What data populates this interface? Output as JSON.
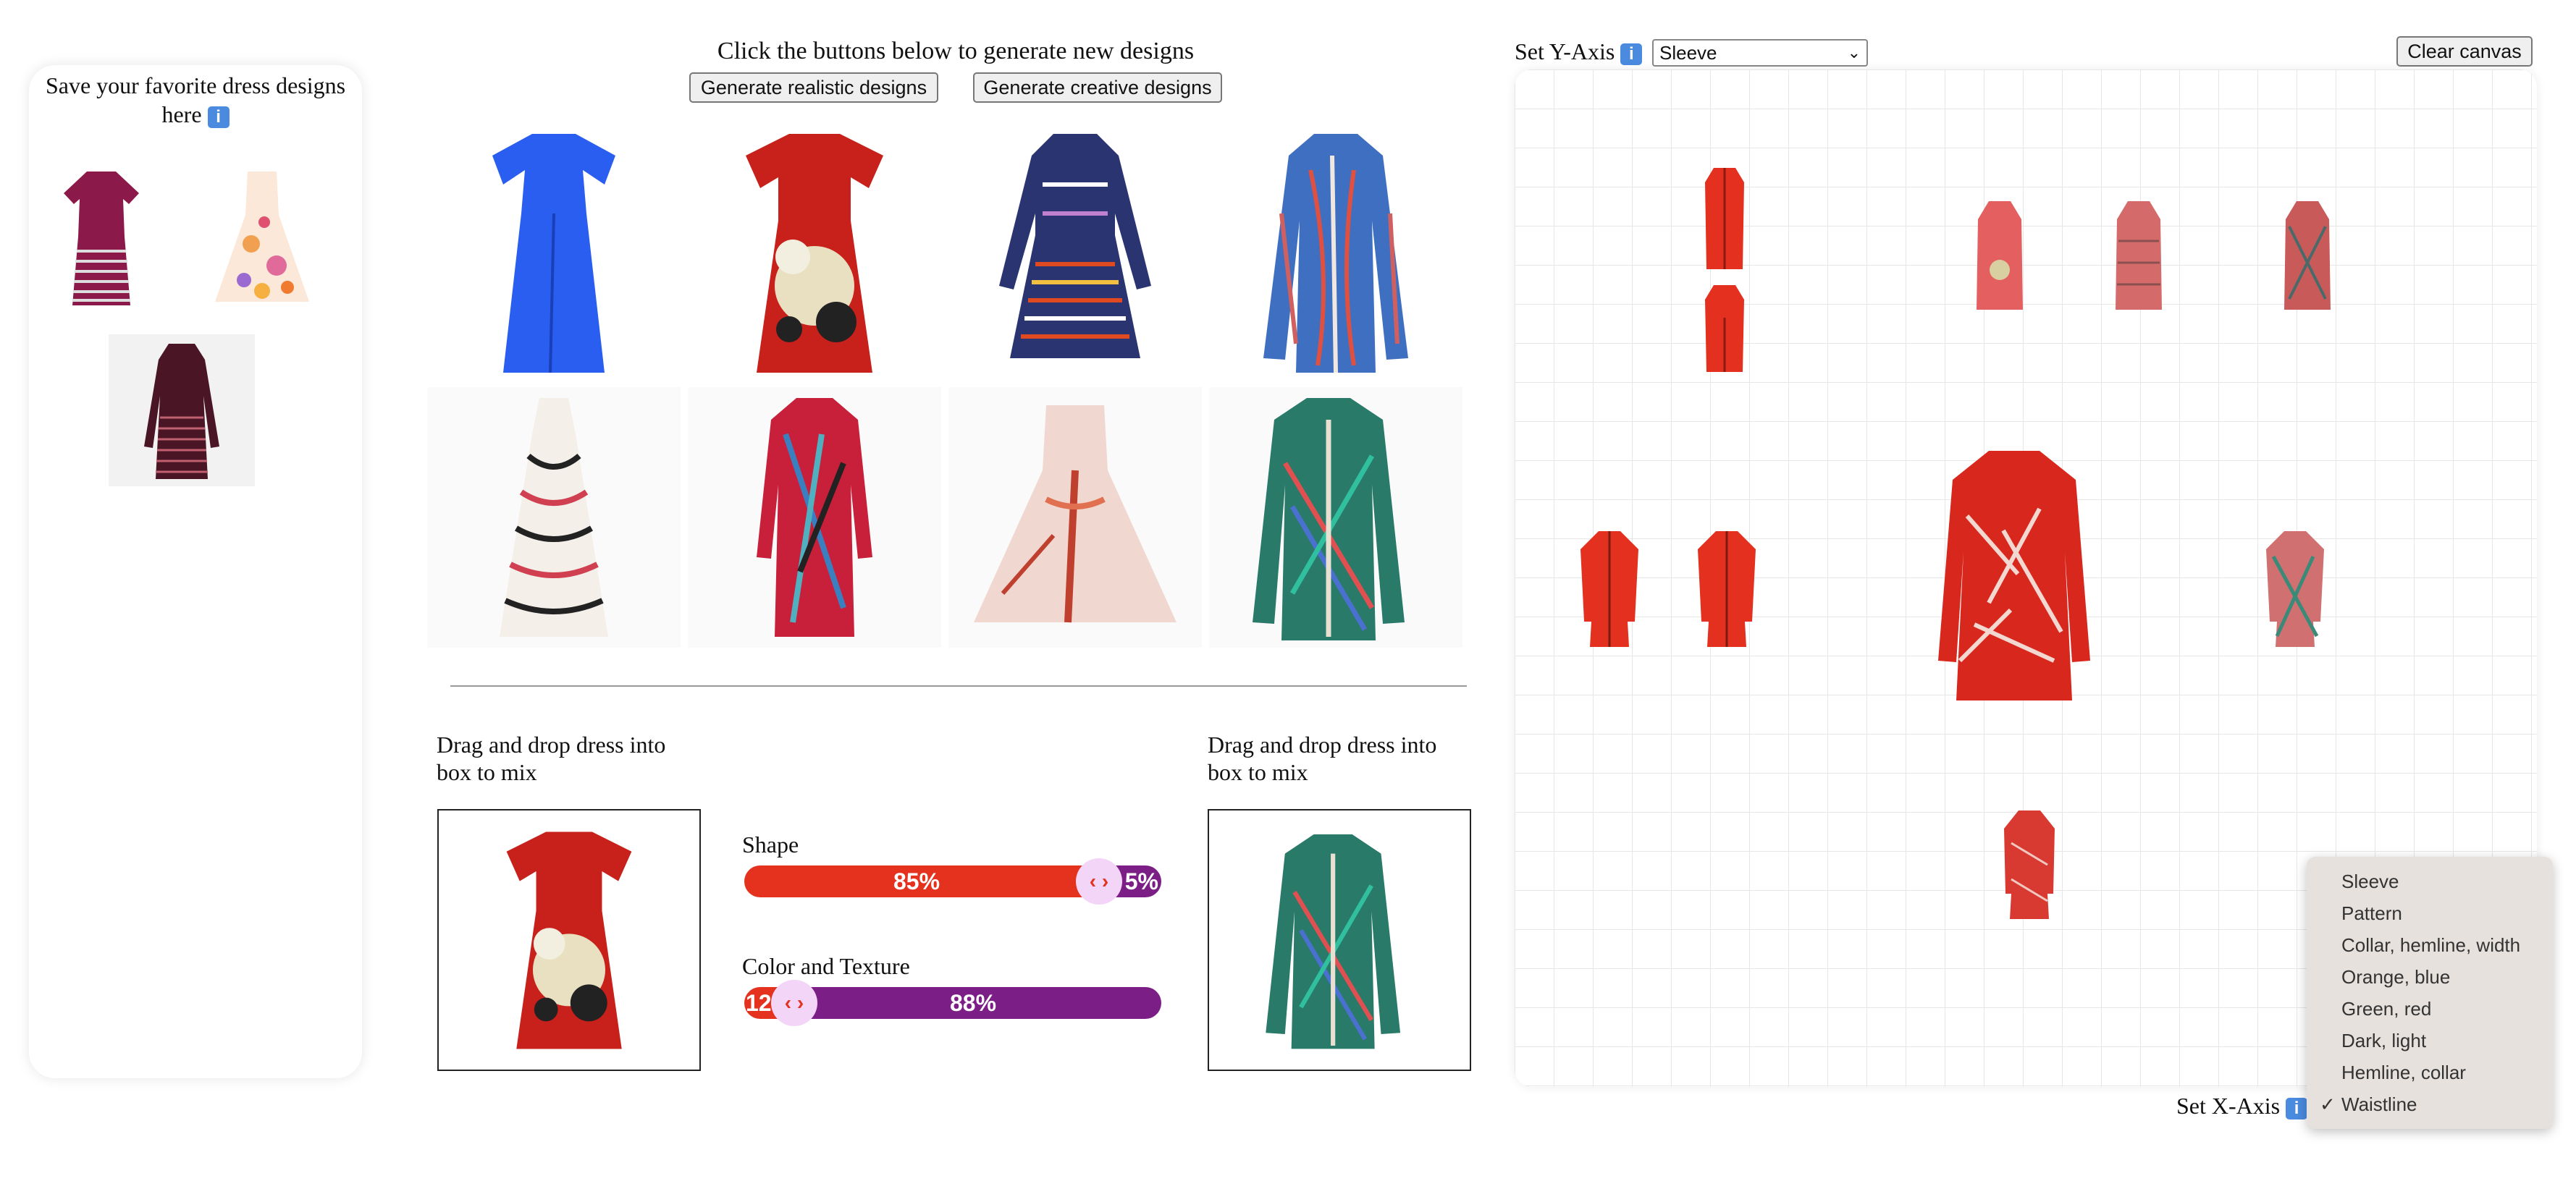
{
  "favorites": {
    "title": "Save your favorite dress designs here"
  },
  "generator": {
    "instruction": "Click the buttons below to generate new designs",
    "realistic_button": "Generate realistic designs",
    "creative_button": "Generate creative designs"
  },
  "mixer": {
    "left_label": "Drag and drop dress into box to mix",
    "right_label": "Drag and drop dress into box to mix",
    "shape_label": "Shape",
    "shape_left_pct": "85%",
    "shape_right_pct": "5%",
    "shape_value": 0.85,
    "color_label": "Color and Texture",
    "color_left_pct": "12",
    "color_right_pct": "88%",
    "color_value": 0.12
  },
  "canvas": {
    "y_axis_label": "Set Y-Axis",
    "y_axis_value": "Sleeve",
    "x_axis_label": "Set X-Axis",
    "clear_button": "Clear canvas"
  },
  "x_axis_menu": {
    "options": [
      "Sleeve",
      "Pattern",
      "Collar, hemline, width",
      "Orange, blue",
      "Green, red",
      "Dark, light",
      "Hemline, collar",
      "Waistline"
    ],
    "selected": "Waistline",
    "checkmark": "✓"
  },
  "info_glyph": "i",
  "colors": {
    "accent_red": "#e5321f",
    "accent_purple": "#7b1f86",
    "handle_pink": "#f3d6f7"
  }
}
